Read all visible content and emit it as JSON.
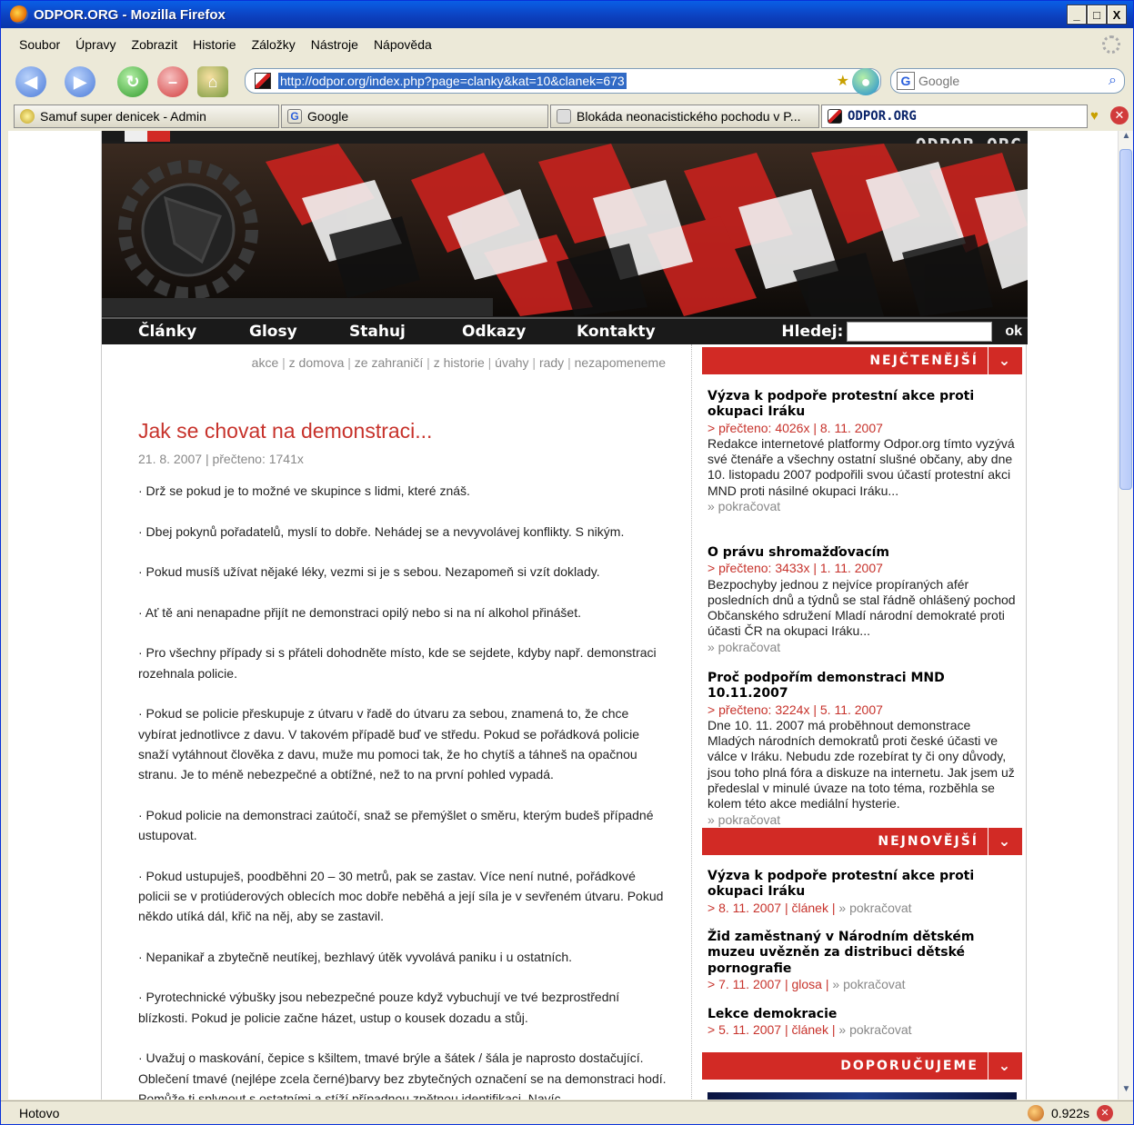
{
  "window": {
    "title": "ODPOR.ORG - Mozilla Firefox",
    "buttons": {
      "minimize": "_",
      "maximize": "□",
      "close": "X"
    }
  },
  "menu": [
    "Soubor",
    "Úpravy",
    "Zobrazit",
    "Historie",
    "Záložky",
    "Nástroje",
    "Nápověda"
  ],
  "toolbar": {
    "url": "http://odpor.org/index.php?page=clanky&kat=10&clanek=673",
    "search_placeholder": "Google",
    "search_engine_letter": "G"
  },
  "tabs": [
    {
      "label": "Samuf super denicek - Admin"
    },
    {
      "label": "Google"
    },
    {
      "label": "Blokáda neonacistického pochodu v P..."
    },
    {
      "label": "ODPOR.ORG"
    }
  ],
  "site": {
    "brand": "ODPOR.ORG",
    "nav": [
      "Články",
      "Glosy",
      "Stahuj",
      "Odkazy",
      "Kontakty"
    ],
    "search_label": "Hledej:",
    "search_button": "ok",
    "colors": {
      "accent": "#d22a25",
      "nav_bg": "#1a1a1a",
      "title_red": "#c7322b"
    }
  },
  "subnav": [
    "akce",
    "z domova",
    "ze zahraničí",
    "z historie",
    "úvahy",
    "rady",
    "nezapomeneme"
  ],
  "article": {
    "title": "Jak se chovat na demonstraci...",
    "meta": "21. 8. 2007 | přečteno: 1741x",
    "paragraphs": [
      "· Drž se pokud je to možné ve skupince s lidmi, které znáš.",
      "· Dbej pokynů pořadatelů, myslí to dobře. Nehádej se a nevyvolávej konflikty. S nikým.",
      "· Pokud musíš užívat nějaké léky, vezmi si je s sebou. Nezapomeň si vzít doklady.",
      "· Ať tě ani nenapadne přijít ne demonstraci opilý nebo si na ní alkohol přinášet.",
      "· Pro všechny případy si s přáteli dohodněte místo, kde se sejdete, kdyby např. demonstraci rozehnala policie.",
      "· Pokud se policie přeskupuje z útvaru v řadě do útvaru za sebou, znamená to, že chce vybírat jednotlivce z davu. V takovém případě buď ve středu. Pokud se pořádková policie snaží vytáhnout člověka z davu, muže mu pomoci tak, že ho chytíš a táhneš na opačnou stranu. Je to méně nebezpečné a obtížné, než to na první pohled vypadá.",
      "· Pokud policie na demonstraci zaútočí, snaž se přemýšlet o směru, kterým budeš případné ustupovat.",
      "· Pokud ustupuješ, poodběhni 20 – 30 metrů, pak se zastav. Více není nutné, pořádkové policii se v protiúderových oblecích moc dobře neběhá a její síla je v sevřeném útvaru. Pokud někdo utíká dál, křič na něj, aby se zastavil.",
      "· Nepanikař a zbytečně neutíkej, bezhlavý útěk vyvolává paniku i u ostatních.",
      "· Pyrotechnické výbušky jsou nebezpečné pouze když vybuchují ve tvé bezprostřední blízkosti. Pokud je policie začne házet, ustup o kousek dozadu a stůj.",
      "· Uvažuj o maskování, čepice s kšiltem, tmavé brýle a šátek / šála je naprosto dostačující. Oblečení tmavé (nejlépe zcela černé)barvy bez zbytečných označení se na demonstraci hodí. Pomůže ti splynout s ostatními a stíží případnou zpětnou identifikaci. Navíc"
    ]
  },
  "sidebar": {
    "most_read": {
      "heading": "NEJČTENĚJŠÍ",
      "items": [
        {
          "title": "Výzva k podpoře protestní akce proti okupaci Iráku",
          "meta": "> přečteno: 4026x | 8. 11. 2007",
          "text": "Redakce internetové platformy Odpor.org tímto vyzývá své čtenáře a všechny ostatní slušné občany, aby dne 10. listopadu 2007 podpořili svou účastí protestní akci MND proti násilné okupaci Iráku...",
          "more": "» pokračovat"
        },
        {
          "title": "O právu shromažďovacím",
          "meta": "> přečteno: 3433x | 1. 11. 2007",
          "text": "Bezpochyby jednou z nejvíce propíraných afér posledních dnů a týdnů se stal řádně ohlášený pochod Občanského sdružení Mladí národní demokraté proti účasti ČR na okupaci Iráku...",
          "more": "» pokračovat"
        },
        {
          "title": "Proč podpořím demonstraci MND 10.11.2007",
          "meta": "> přečteno: 3224x | 5. 11. 2007",
          "text": "Dne 10. 11. 2007 má proběhnout demonstrace Mladých národních demokratů proti české účasti ve válce v Iráku. Nebudu zde rozebírat ty či ony důvody, jsou toho plná fóra a diskuze na internetu. Jak jsem už předeslal v minulé úvaze na toto téma, rozběhla se kolem této akce mediální hysterie.",
          "more": "» pokračovat"
        }
      ]
    },
    "newest": {
      "heading": "NEJNOVĚJŠÍ",
      "items": [
        {
          "title": "Výzva k podpoře protestní akce proti okupaci Iráku",
          "meta": "> 8. 11. 2007 | článek |",
          "more": "» pokračovat"
        },
        {
          "title": "Žid zaměstnaný v Národním dětském muzeu uvězněn za distribuci dětské pornografie",
          "meta": "> 7. 11. 2007 | glosa |",
          "more": "» pokračovat"
        },
        {
          "title": "Lekce demokracie",
          "meta": "> 5. 11. 2007 | článek |",
          "more": "» pokračovat"
        }
      ]
    },
    "recommended": {
      "heading": "DOPORUČUJEME"
    },
    "chevron": "⌄"
  },
  "status": {
    "text": "Hotovo",
    "timing": "0.922s"
  }
}
